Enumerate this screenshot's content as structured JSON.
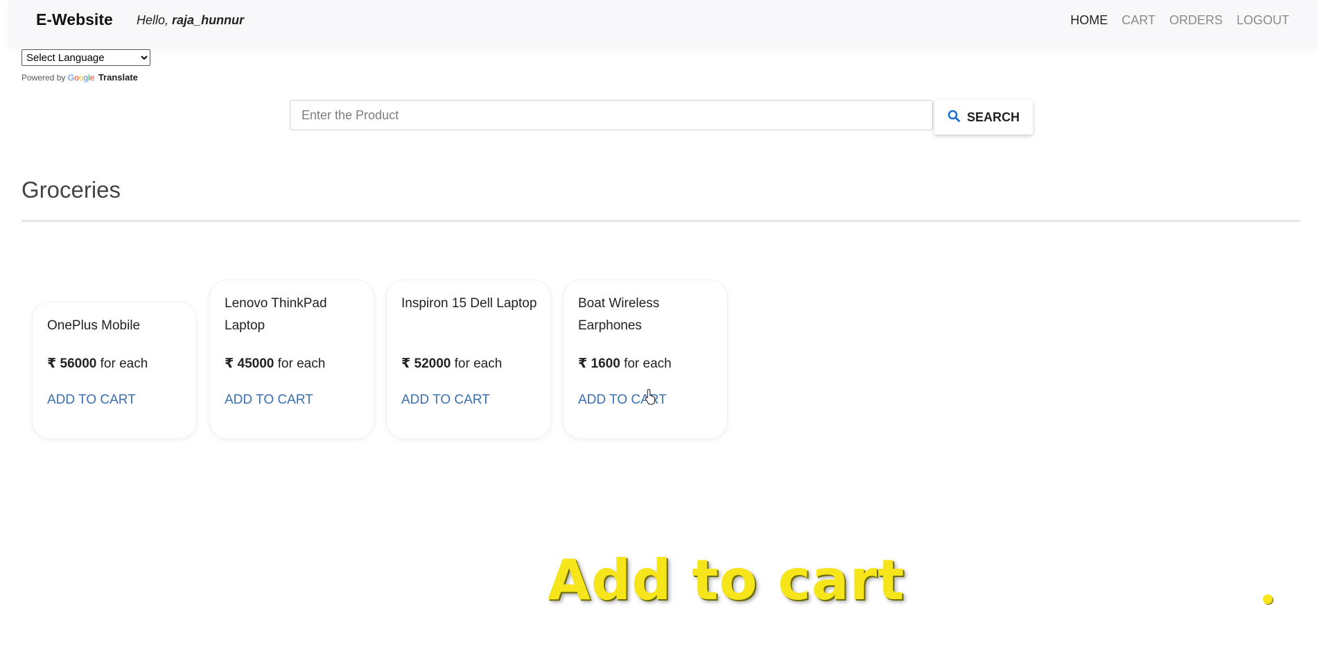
{
  "navbar": {
    "brand": "E-Website",
    "greeting_prefix": "Hello, ",
    "username": "raja_hunnur",
    "links": [
      {
        "label": "HOME",
        "active": true
      },
      {
        "label": "CART",
        "active": false
      },
      {
        "label": "ORDERS",
        "active": false
      },
      {
        "label": "LOGOUT",
        "active": false
      }
    ]
  },
  "translate": {
    "select_value": "Select Language",
    "powered_by": "Powered by",
    "google_letters": [
      "G",
      "o",
      "o",
      "g",
      "l",
      "e"
    ],
    "translate_label": "Translate"
  },
  "search": {
    "placeholder": "Enter the Product",
    "value": "",
    "button_label": "SEARCH",
    "icon": "search-icon"
  },
  "section": {
    "title": "Groceries"
  },
  "products": [
    {
      "name": "OnePlus Mobile",
      "currency": "₹",
      "price": "56000",
      "unit": "for each",
      "add_label": "ADD TO CART"
    },
    {
      "name": "Lenovo ThinkPad Laptop",
      "currency": "₹",
      "price": "45000",
      "unit": "for each",
      "add_label": "ADD TO CART"
    },
    {
      "name": "Inspiron 15 Dell Laptop",
      "currency": "₹",
      "price": "52000",
      "unit": "for each",
      "add_label": "ADD TO CART"
    },
    {
      "name": "Boat Wireless Earphones",
      "currency": "₹",
      "price": "1600",
      "unit": "for each",
      "add_label": "ADD TO CART"
    }
  ],
  "overlay": {
    "caption": "Add to cart",
    "caption_color": "#f5e51a"
  },
  "colors": {
    "link_blue": "#3b6fb0",
    "search_icon_blue": "#1f6fd1"
  }
}
